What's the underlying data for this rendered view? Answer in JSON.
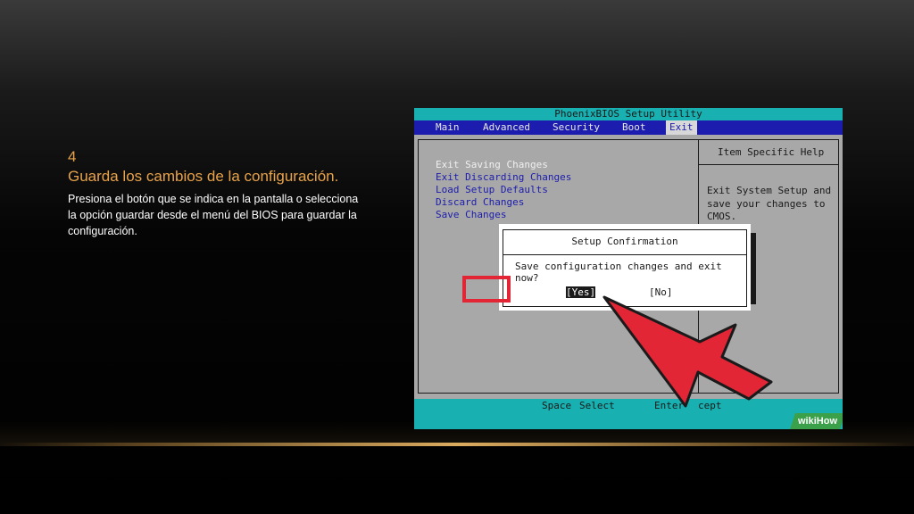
{
  "slide": {
    "step_number": "4",
    "step_title": "Guarda los cambios de la configuración.",
    "step_description": "Presiona el botón que se indica en la pantalla o selecciona la opción guardar desde el menú del BIOS para guardar la configuración."
  },
  "bios": {
    "title": "PhoenixBIOS Setup Utility",
    "menu": [
      "Main",
      "Advanced",
      "Security",
      "Boot",
      "Exit"
    ],
    "active_menu": "Exit",
    "exit_options": [
      "Exit Saving Changes",
      "Exit Discarding Changes",
      "Load Setup Defaults",
      "Discard Changes",
      "Save Changes"
    ],
    "help_title": "Item Specific Help",
    "help_text": "Exit System Setup and save your changes to CMOS.",
    "dialog": {
      "title": "Setup Confirmation",
      "question": "Save configuration changes and exit now?",
      "yes_label": "[Yes]",
      "no_label": "[No]"
    },
    "footer": {
      "space_key": "Space",
      "space_action": "Select",
      "enter_key": "Enter",
      "enter_action_visible": "cept"
    }
  },
  "watermark": "wikiHow",
  "colors": {
    "accent_text": "#e8a34a",
    "bios_cyan": "#18b0b0",
    "bios_blue": "#1c1cae",
    "arrow_red": "#e32636",
    "wikihow_green": "#3aa14a"
  }
}
